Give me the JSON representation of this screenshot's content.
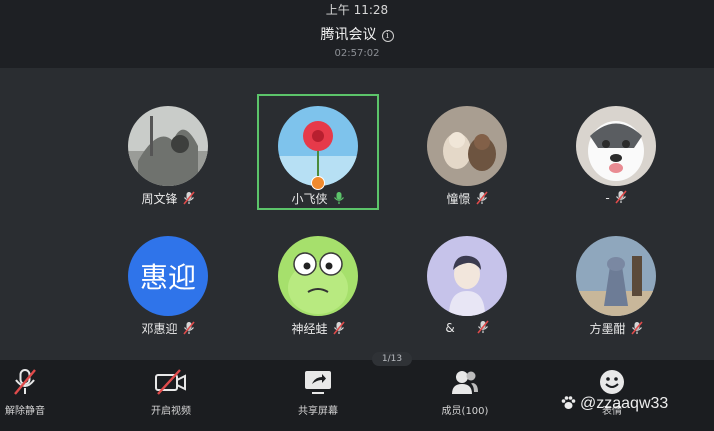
{
  "status": {
    "time": "上午 11:28"
  },
  "meeting": {
    "title": "腾讯会议",
    "timer": "02:57:02"
  },
  "participants": [
    {
      "name": "周文锋",
      "mic": "muted"
    },
    {
      "name": "小飞侠",
      "mic": "speaking",
      "host": true
    },
    {
      "name": "憧憬",
      "mic": "muted"
    },
    {
      "name": "-",
      "mic": "muted"
    },
    {
      "name": "邓惠迎",
      "mic": "muted",
      "avatar_text": "惠迎",
      "avatar_color": "#2f74ea"
    },
    {
      "name": "神经蛙",
      "mic": "muted"
    },
    {
      "name": "&",
      "mic": "muted"
    },
    {
      "name": "方墨酣",
      "mic": "muted"
    }
  ],
  "pagination": {
    "label": "1/13"
  },
  "toolbar": {
    "unmute": "解除静音",
    "start_video": "开启视频",
    "share_screen": "共享屏幕",
    "members": "成员(100)",
    "reactions": "表情"
  },
  "watermark": {
    "text": "@zzaaqw33"
  },
  "colors": {
    "speaking_border": "#5cc46a",
    "mute_slash": "#e04b4b",
    "host_badge": "#f08a2e"
  }
}
